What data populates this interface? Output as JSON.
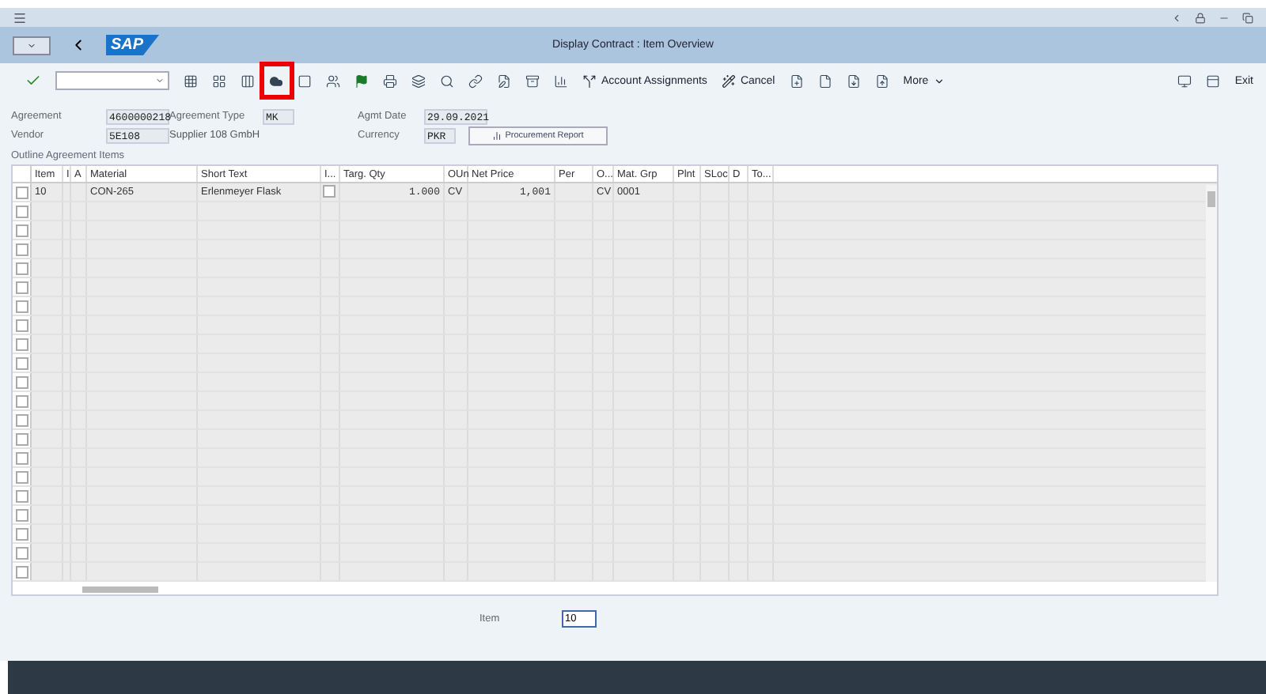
{
  "window": {
    "title": "Display Contract : Item Overview",
    "logo": "SAP"
  },
  "toolbar": {
    "buttons": [
      {
        "label": "Account Assignments"
      },
      {
        "label": "Cancel"
      },
      {
        "label": "More"
      }
    ],
    "exit": "Exit",
    "highlighted_icon": true
  },
  "header": {
    "fields": [
      {
        "label": "Agreement",
        "value": "4600000218",
        "extra_label": "Agreement Type",
        "extra_value": "MK",
        "right_label": "Agmt Date",
        "right_value": "29.09.2021"
      },
      {
        "label": "Vendor",
        "value": "5E108",
        "extra_text": "Supplier 108 GmbH",
        "right_label": "Currency",
        "right_value": "PKR"
      }
    ],
    "report_button": "Procurement Report"
  },
  "table": {
    "title": "Outline Agreement Items",
    "columns": [
      "Item",
      "I",
      "A",
      "Material",
      "Short Text",
      "I...",
      "Targ. Qty",
      "OUn",
      "Net Price",
      "Per",
      "O...",
      "Mat. Grp",
      "Plnt",
      "SLoc",
      "D",
      "To..."
    ],
    "rows": [
      {
        "selected": false,
        "cells": [
          "10",
          "",
          "",
          "CON-265",
          "Erlenmeyer Flask",
          {
            "checked": false
          },
          "1.000",
          "CV",
          "1,001",
          "",
          "CV",
          "0001",
          "",
          "",
          "",
          ""
        ]
      },
      {
        "selected": false
      },
      {
        "selected": false
      },
      {
        "selected": false
      },
      {
        "selected": false
      },
      {
        "selected": false
      },
      {
        "selected": false
      },
      {
        "selected": false
      },
      {
        "selected": false
      },
      {
        "selected": false
      },
      {
        "selected": false
      },
      {
        "selected": false
      },
      {
        "selected": false
      },
      {
        "selected": false
      },
      {
        "selected": false
      },
      {
        "selected": false
      },
      {
        "selected": false
      },
      {
        "selected": false
      },
      {
        "selected": false
      },
      {
        "selected": false
      },
      {
        "selected": false
      }
    ]
  },
  "footer": {
    "item_label": "Item",
    "item_value": "10"
  }
}
